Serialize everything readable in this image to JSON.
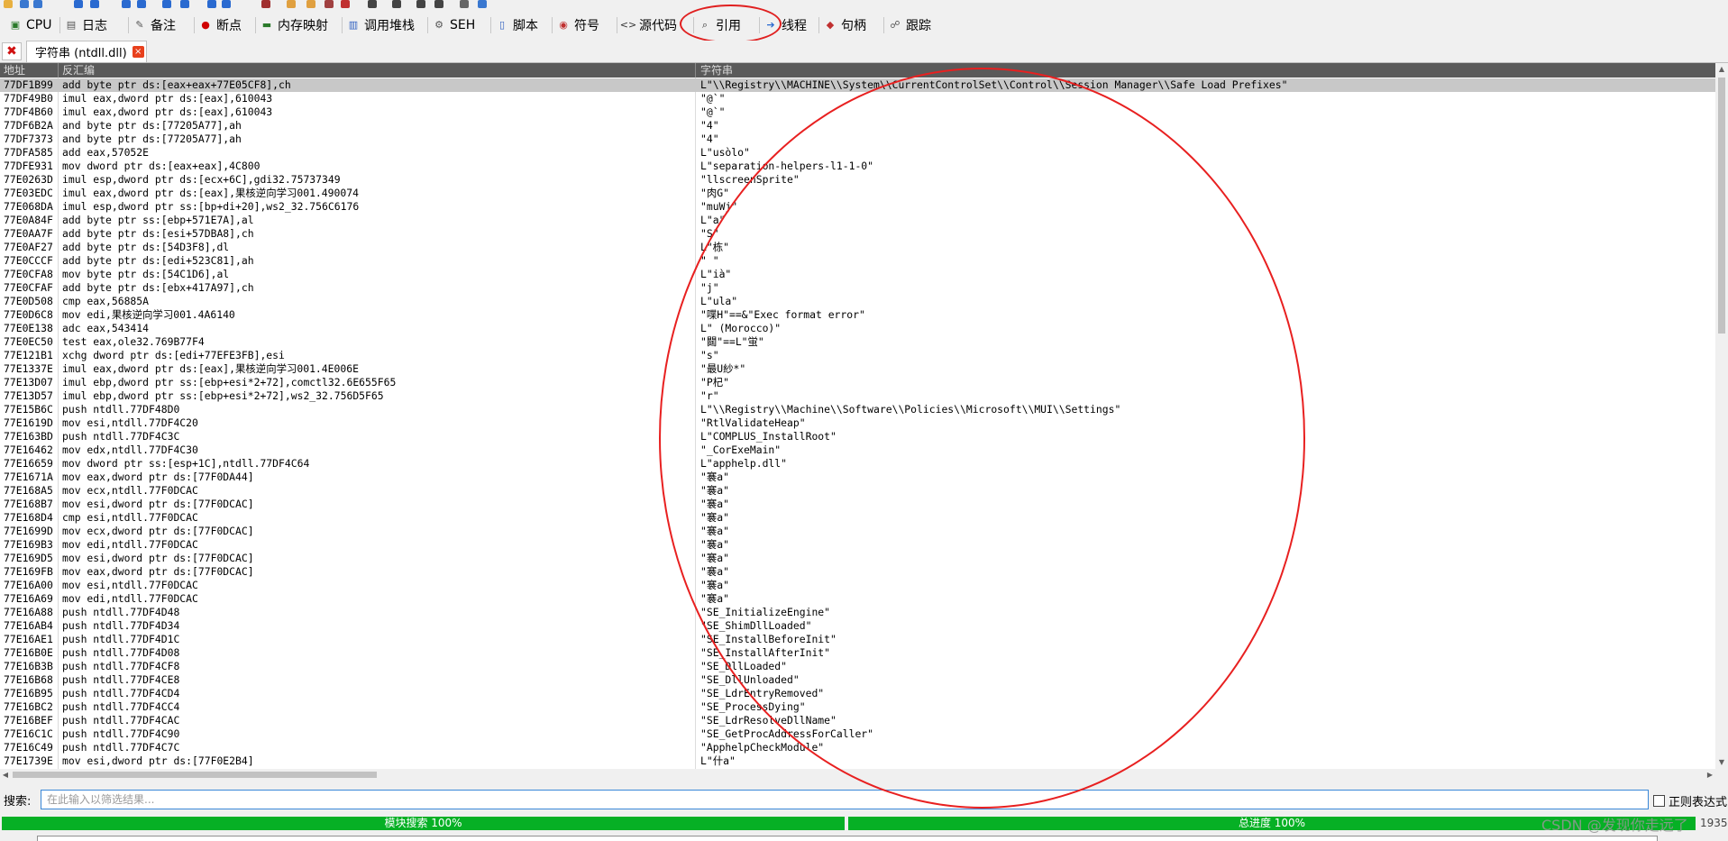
{
  "tabs": [
    {
      "icon": "cpu-icon",
      "glyph": "▣",
      "color": "#2a7a2a",
      "label": "CPU"
    },
    {
      "icon": "log-icon",
      "glyph": "▤",
      "color": "#555555",
      "label": "日志"
    },
    {
      "icon": "notes-icon",
      "glyph": "✎",
      "color": "#555555",
      "label": "备注"
    },
    {
      "icon": "breakpoint-icon",
      "glyph": "●",
      "color": "#d00000",
      "label": "断点"
    },
    {
      "icon": "memory-map-icon",
      "glyph": "▬",
      "color": "#2a7a2a",
      "label": "内存映射"
    },
    {
      "icon": "call-stack-icon",
      "glyph": "▥",
      "color": "#3060c0",
      "label": "调用堆栈"
    },
    {
      "icon": "seh-icon",
      "glyph": "⚙",
      "color": "#555555",
      "label": "SEH"
    },
    {
      "icon": "script-icon",
      "glyph": "▯",
      "color": "#3060c0",
      "label": "脚本"
    },
    {
      "icon": "symbols-icon",
      "glyph": "◉",
      "color": "#c03030",
      "label": "符号"
    },
    {
      "icon": "source-icon",
      "glyph": "<>",
      "color": "#333333",
      "label": "源代码"
    },
    {
      "icon": "references-icon",
      "glyph": "⌕",
      "color": "#333333",
      "label": "引用"
    },
    {
      "icon": "threads-icon",
      "glyph": "➔",
      "color": "#2a6ad0",
      "label": "线程"
    },
    {
      "icon": "handles-icon",
      "glyph": "◆",
      "color": "#c03030",
      "label": "句柄"
    },
    {
      "icon": "trace-icon",
      "glyph": "☍",
      "color": "#555555",
      "label": "跟踪"
    }
  ],
  "doc_tab": {
    "label": "字符串 (ntdll.dll)",
    "close": "×"
  },
  "close_all": "✖",
  "columns": {
    "address": "地址",
    "disassembly": "反汇编",
    "string": "字符串"
  },
  "rows": [
    [
      "77DF1B99",
      "add byte ptr ds:[eax+eax+77E05CF8],ch",
      "L\"\\\\Registry\\\\MACHINE\\\\System\\\\CurrentControlSet\\\\Control\\\\Session Manager\\\\Safe Load Prefixes\""
    ],
    [
      "77DF49B0",
      "imul eax,dword ptr ds:[eax],610043",
      "\"@`\""
    ],
    [
      "77DF4B60",
      "imul eax,dword ptr ds:[eax],610043",
      "\"@`\""
    ],
    [
      "77DF6B2A",
      "and byte ptr ds:[77205A77],ah",
      "\"4\""
    ],
    [
      "77DF7373",
      "and byte ptr ds:[77205A77],ah",
      "\"4\""
    ],
    [
      "77DFA585",
      "add eax,57052E",
      "L\"usòlo\""
    ],
    [
      "77DFE931",
      "mov dword ptr ds:[eax+eax],4C800",
      "L\"separation-helpers-l1-1-0\""
    ],
    [
      "77E0263D",
      "imul esp,dword ptr ds:[ecx+6C],gdi32.75737349",
      "\"llscreenSprite\""
    ],
    [
      "77E03EDC",
      "imul eax,dword ptr ds:[eax],果核逆向学习001.490074",
      "\"肉G\""
    ],
    [
      "77E068DA",
      "imul esp,dword ptr ss:[bp+di+20],ws2_32.756C6176",
      "\"muWj\""
    ],
    [
      "77E0A84F",
      "add byte ptr ss:[ebp+571E7A],al",
      "L\"a\""
    ],
    [
      "77E0AA7F",
      "add byte ptr ds:[esi+57DBA8],ch",
      "\"S\""
    ],
    [
      "77E0AF27",
      "add byte ptr ds:[54D3F8],dl",
      "L\"栋\""
    ],
    [
      "77E0CCCF",
      "add byte ptr ds:[edi+523C81],ah",
      "\" \""
    ],
    [
      "77E0CFA8",
      "mov byte ptr ds:[54C1D6],al",
      "L\"ià\""
    ],
    [
      "77E0CFAF",
      "add byte ptr ds:[ebx+417A97],ch",
      "\"j\""
    ],
    [
      "77E0D508",
      "cmp eax,56885A",
      "L\"ula\""
    ],
    [
      "77E0D6C8",
      "mov edi,果核逆向学习001.4A6140",
      "\"喋H\"==&\"Exec format error\""
    ],
    [
      "77E0E138",
      "adc eax,543414",
      "L\" (Morocco)\""
    ],
    [
      "77E0EC50",
      "test eax,ole32.769B77F4",
      "\"閮\"==L\"蛍\""
    ],
    [
      "77E121B1",
      "xchg dword ptr ds:[edi+77EFE3FB],esi",
      "\"s\""
    ],
    [
      "77E1337E",
      "imul eax,dword ptr ds:[eax],果核逆向学习001.4E006E",
      "\"最U紗*\""
    ],
    [
      "77E13D07",
      "imul ebp,dword ptr ss:[ebp+esi*2+72],comctl32.6E655F65",
      "\"P杞\""
    ],
    [
      "77E13D57",
      "imul ebp,dword ptr ss:[ebp+esi*2+72],ws2_32.756D5F65",
      "\"r\""
    ],
    [
      "77E15B6C",
      "push ntdll.77DF48D0",
      "L\"\\\\Registry\\\\Machine\\\\Software\\\\Policies\\\\Microsoft\\\\MUI\\\\Settings\""
    ],
    [
      "77E1619D",
      "mov esi,ntdll.77DF4C20",
      "\"RtlValidateHeap\""
    ],
    [
      "77E163BD",
      "push ntdll.77DF4C3C",
      "L\"COMPLUS_InstallRoot\""
    ],
    [
      "77E16462",
      "mov edx,ntdll.77DF4C30",
      "\"_CorExeMain\""
    ],
    [
      "77E16659",
      "mov dword ptr ss:[esp+1C],ntdll.77DF4C64",
      "L\"apphelp.dll\""
    ],
    [
      "77E1671A",
      "mov eax,dword ptr ds:[77F0DA44]",
      "\"褰a\""
    ],
    [
      "77E168A5",
      "mov ecx,ntdll.77F0DCAC",
      "\"褰a\""
    ],
    [
      "77E168B7",
      "mov esi,dword ptr ds:[77F0DCAC]",
      "\"褰a\""
    ],
    [
      "77E168D4",
      "cmp esi,ntdll.77F0DCAC",
      "\"褰a\""
    ],
    [
      "77E1699D",
      "mov ecx,dword ptr ds:[77F0DCAC]",
      "\"褰a\""
    ],
    [
      "77E169B3",
      "mov edi,ntdll.77F0DCAC",
      "\"褰a\""
    ],
    [
      "77E169D5",
      "mov esi,dword ptr ds:[77F0DCAC]",
      "\"褰a\""
    ],
    [
      "77E169FB",
      "mov eax,dword ptr ds:[77F0DCAC]",
      "\"褰a\""
    ],
    [
      "77E16A00",
      "mov esi,ntdll.77F0DCAC",
      "\"褰a\""
    ],
    [
      "77E16A69",
      "mov edi,ntdll.77F0DCAC",
      "\"褰a\""
    ],
    [
      "77E16A88",
      "push ntdll.77DF4D48",
      "\"SE_InitializeEngine\""
    ],
    [
      "77E16AB4",
      "push ntdll.77DF4D34",
      "\"SE_ShimDllLoaded\""
    ],
    [
      "77E16AE1",
      "push ntdll.77DF4D1C",
      "\"SE_InstallBeforeInit\""
    ],
    [
      "77E16B0E",
      "push ntdll.77DF4D08",
      "\"SE_InstallAfterInit\""
    ],
    [
      "77E16B3B",
      "push ntdll.77DF4CF8",
      "\"SE_DllLoaded\""
    ],
    [
      "77E16B68",
      "push ntdll.77DF4CE8",
      "\"SE_DllUnloaded\""
    ],
    [
      "77E16B95",
      "push ntdll.77DF4CD4",
      "\"SE_LdrEntryRemoved\""
    ],
    [
      "77E16BC2",
      "push ntdll.77DF4CC4",
      "\"SE_ProcessDying\""
    ],
    [
      "77E16BEF",
      "push ntdll.77DF4CAC",
      "\"SE_LdrResolveDllName\""
    ],
    [
      "77E16C1C",
      "push ntdll.77DF4C90",
      "\"SE_GetProcAddressForCaller\""
    ],
    [
      "77E16C49",
      "push ntdll.77DF4C7C",
      "\"ApphelpCheckModule\""
    ],
    [
      "77E1739E",
      "mov esi,dword ptr ds:[77F0E2B4]",
      "L\"什a\""
    ]
  ],
  "search": {
    "label": "搜索:",
    "placeholder": "在此输入以筛选结果...",
    "regex_label": "正则表达式"
  },
  "progress": {
    "module_label": "模块搜索 100%",
    "module_value": 1.0,
    "total_label": "总进度 100%",
    "total_value": 1.0,
    "count": "1935"
  },
  "watermark": "CSDN @发现你走远了",
  "colors": {
    "progress": "#06b025",
    "annotation": "#e02020",
    "header": "#5a5a5a"
  }
}
